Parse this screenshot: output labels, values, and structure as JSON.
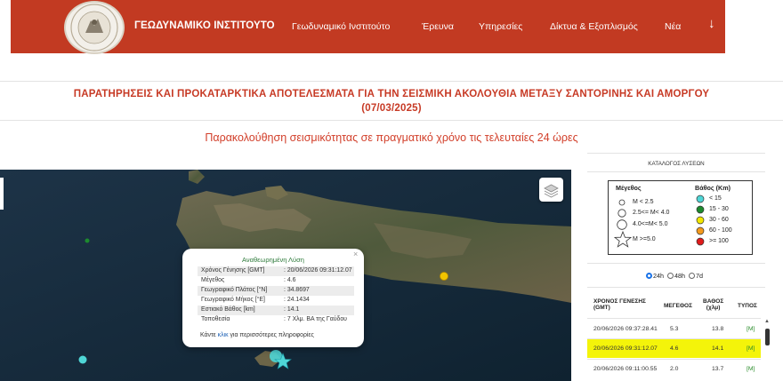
{
  "nav": {
    "brand": "ΓΕΩΔΥΝΑΜΙΚΟ ΙΝΣΤΙΤΟΥΤΟ",
    "items": [
      "Γεωδυναμικό Ινστιτούτο",
      "Έρευνα",
      "Υπηρεσίες",
      "Δίκτυα & Εξοπλισμός",
      "Νέα"
    ],
    "more_icon": "↓"
  },
  "headings": {
    "title_line1": "ΠΑΡΑΤΗΡΗΣΕΙΣ ΚΑΙ ΠΡΟΚΑΤΑΡΚΤΙΚΑ ΑΠΟΤΕΛΕΣΜΑΤΑ ΓΙΑ ΤΗΝ ΣΕΙΣΜΙΚΗ ΑΚΟΛΟΥΘΙΑ ΜΕΤΑΞΥ ΣΑΝΤΟΡΙΝΗΣ ΚΑΙ ΑΜΟΡΓΟΥ",
    "title_line2": "(07/03/2025)",
    "subtitle": "Παρακολούθηση σεισμικότητας σε πραγματικό χρόνο τις τελευταίες 24 ώρες"
  },
  "popup": {
    "title": "Αναθεωρημένη Λύση",
    "close": "×",
    "rows": [
      {
        "label": "Χρόνος Γένησης [GMT]",
        "value": ": 20/06/2026 09:31:12.07"
      },
      {
        "label": "Μέγεθος",
        "value": ": 4.6"
      },
      {
        "label": "Γεωγραφικό Πλάτος [°N]",
        "value": ": 34.8697"
      },
      {
        "label": "Γεωγραφικό Μήκος [°E]",
        "value": ": 24.1434"
      },
      {
        "label": "Εστιακό Βάθος [km]",
        "value": ": 14.1"
      },
      {
        "label": "Τοποθεσία",
        "value": ": 7 Χλμ. ΒΑ της Γαύδου"
      }
    ],
    "footer_pre": "Κάντε",
    "footer_link": "κλικ",
    "footer_post": "για περισσότερες πληροφορίες"
  },
  "legend": {
    "catalog_title": "ΚΑΤΑΛΟΓΟΣ ΛΥΣΕΩΝ",
    "magnitude_title": "Μέγεθος",
    "depth_title": "Βάθος (Km)",
    "magnitudes": [
      "M < 2.5",
      "2.5<= M< 4.0",
      "4.0<=M< 5.0",
      "M >=5.0"
    ],
    "depths": [
      {
        "label": "< 15",
        "color": "#4fd6d6"
      },
      {
        "label": "15 - 30",
        "color": "#1d8a2e"
      },
      {
        "label": "30 - 60",
        "color": "#f2e600"
      },
      {
        "label": "60 - 100",
        "color": "#f39a1c"
      },
      {
        "label": ">= 100",
        "color": "#e01b1b"
      }
    ]
  },
  "periods": {
    "options": [
      "24h",
      "48h",
      "7d"
    ],
    "selected": "24h"
  },
  "table": {
    "headers": {
      "time_line1": "ΧΡΟΝΟΣ ΓΕΝΕΣΗΣ",
      "time_line2": "(GMT)",
      "mag": "ΜΕΓΕΘΟΣ",
      "depth_line1": "ΒΑΘΟΣ",
      "depth_line2": "(χλμ)",
      "type": "ΤΥΠΟΣ"
    },
    "rows": [
      {
        "time": "20/06/2026 09:37:28.41",
        "mag": "5.3",
        "depth": "13.8",
        "type": "[M]",
        "highlight": false
      },
      {
        "time": "20/06/2026 09:31:12.07",
        "mag": "4.6",
        "depth": "14.1",
        "type": "[M]",
        "highlight": true
      },
      {
        "time": "20/06/2026 09:11:00.55",
        "mag": "2.0",
        "depth": "13.7",
        "type": "[M]",
        "highlight": false
      }
    ]
  },
  "colors": {
    "brand_red": "#c23a22",
    "highlight": "#f4f40a",
    "link": "#1a5fb4"
  }
}
